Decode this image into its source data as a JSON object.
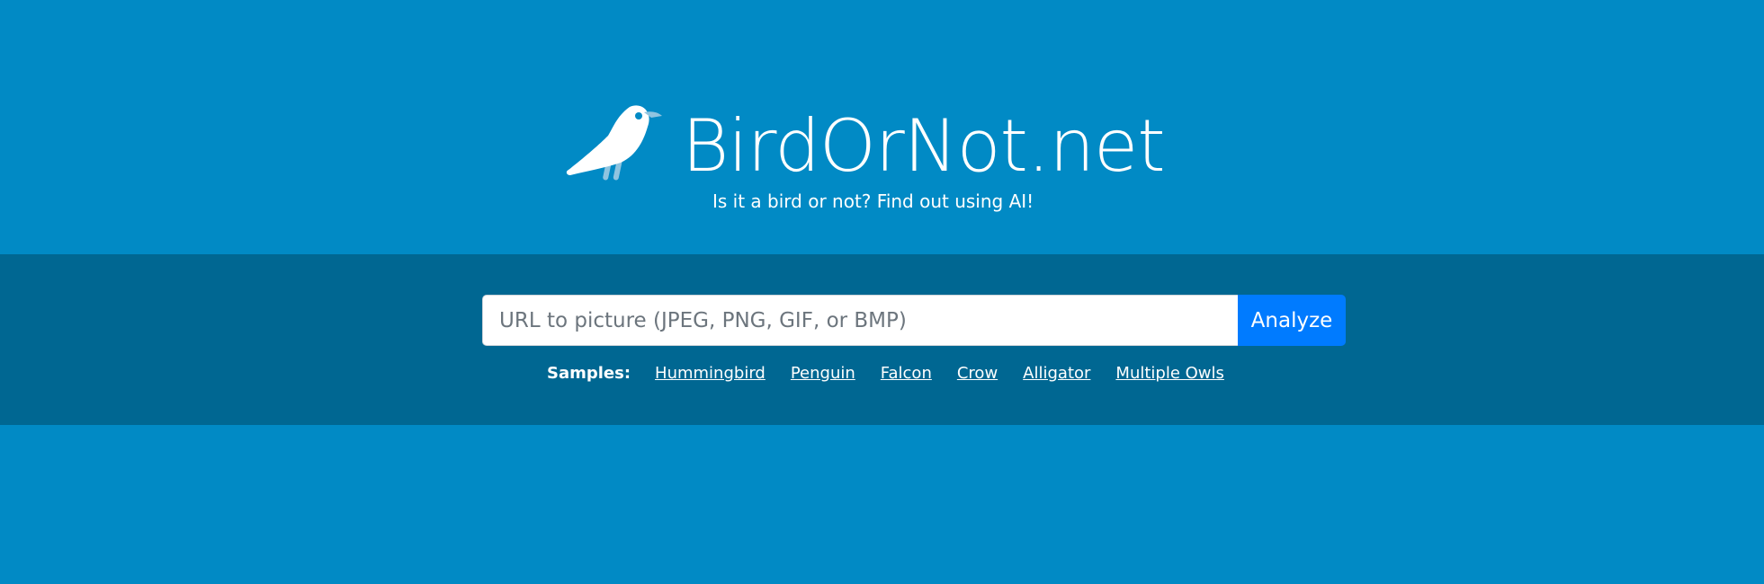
{
  "header": {
    "brand": "BirdOrNot.net",
    "tagline": "Is it a bird or not? Find out using AI!",
    "logo_icon": "bird-icon"
  },
  "search": {
    "placeholder": "URL to picture (JPEG, PNG, GIF, or BMP)",
    "value": "",
    "button_label": "Analyze"
  },
  "samples": {
    "label": "Samples:",
    "links": [
      "Hummingbird",
      "Penguin",
      "Falcon",
      "Crow",
      "Alligator",
      "Multiple Owls"
    ]
  },
  "colors": {
    "background": "#018ac5",
    "band": "#006792",
    "button": "#007bff",
    "text": "#ffffff"
  }
}
